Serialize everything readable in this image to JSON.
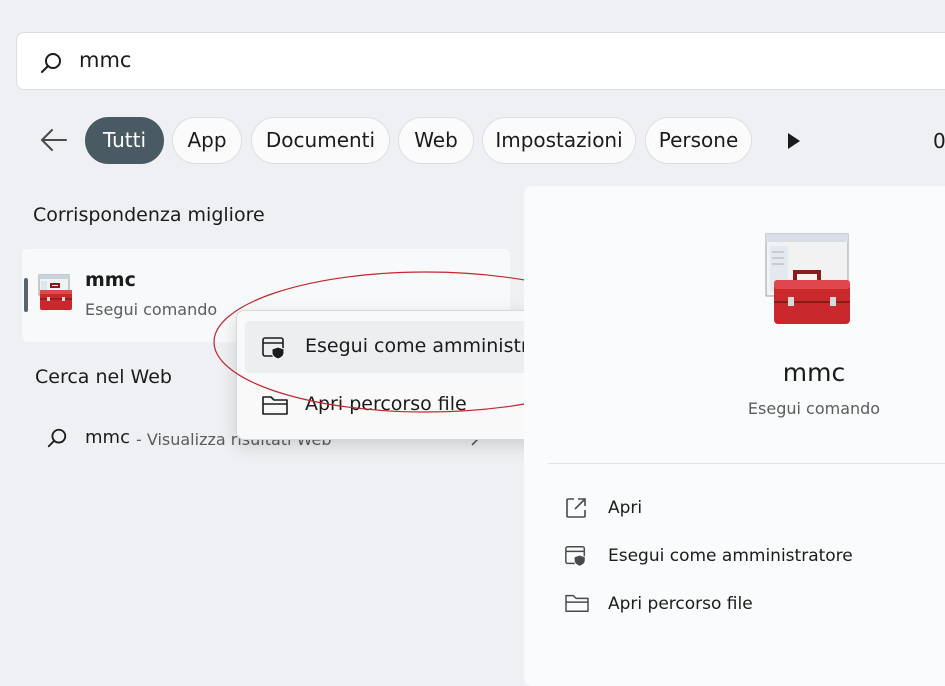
{
  "search": {
    "query": "mmc"
  },
  "filters": {
    "tabs": [
      {
        "label": "Tutti",
        "active": true
      },
      {
        "label": "App"
      },
      {
        "label": "Documenti"
      },
      {
        "label": "Web"
      },
      {
        "label": "Impostazioni"
      },
      {
        "label": "Persone"
      }
    ],
    "edge_text": "0"
  },
  "best_match": {
    "title": "Corrispondenza migliore",
    "name": "mmc",
    "type": "Esegui comando"
  },
  "web_search": {
    "title": "Cerca nel Web",
    "query": "mmc",
    "hint": "- Visualizza risultati Web"
  },
  "context_menu": {
    "items": [
      {
        "label": "Esegui come amministratore",
        "icon": "shield-window-icon"
      },
      {
        "label": "Apri percorso file",
        "icon": "folder-icon"
      }
    ]
  },
  "detail": {
    "name": "mmc",
    "type": "Esegui comando",
    "actions": [
      {
        "label": "Apri",
        "icon": "open-external-icon"
      },
      {
        "label": "Esegui come amministratore",
        "icon": "shield-window-icon"
      },
      {
        "label": "Apri percorso file",
        "icon": "folder-icon"
      }
    ]
  },
  "colors": {
    "active_tab": "#4a5a63",
    "annotation": "#c0282e",
    "toolbox_red": "#c9282d"
  }
}
